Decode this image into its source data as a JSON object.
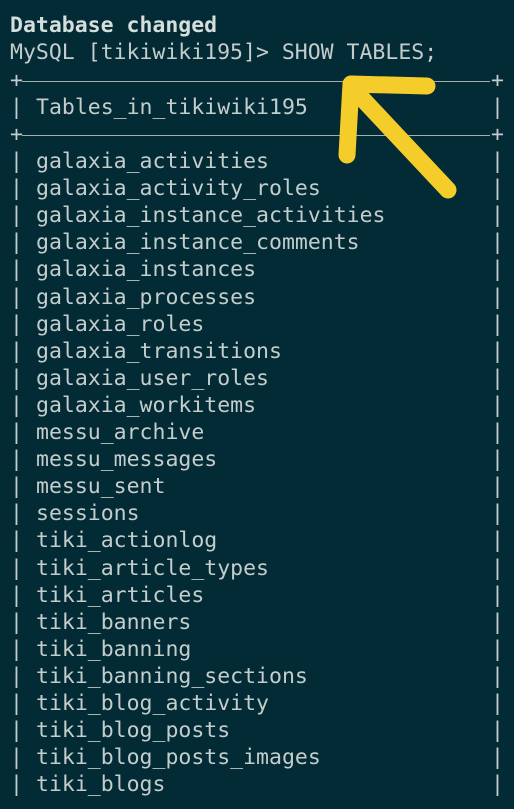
{
  "terminal": {
    "status_line": "Database changed",
    "prompt": "MySQL [tikiwiki195]> ",
    "command": "SHOW TABLES;",
    "header": "Tables_in_tikiwiki195",
    "rows": [
      "galaxia_activities",
      "galaxia_activity_roles",
      "galaxia_instance_activities",
      "galaxia_instance_comments",
      "galaxia_instances",
      "galaxia_processes",
      "galaxia_roles",
      "galaxia_transitions",
      "galaxia_user_roles",
      "galaxia_workitems",
      "messu_archive",
      "messu_messages",
      "messu_sent",
      "sessions",
      "tiki_actionlog",
      "tiki_article_types",
      "tiki_articles",
      "tiki_banners",
      "tiki_banning",
      "tiki_banning_sections",
      "tiki_blog_activity",
      "tiki_blog_posts",
      "tiki_blog_posts_images",
      "tiki_blogs"
    ]
  },
  "annotation": {
    "icon": "arrow-icon",
    "color": "#f5cd2a"
  },
  "colors": {
    "background": "#022b36",
    "text": "#c4cdcb"
  }
}
